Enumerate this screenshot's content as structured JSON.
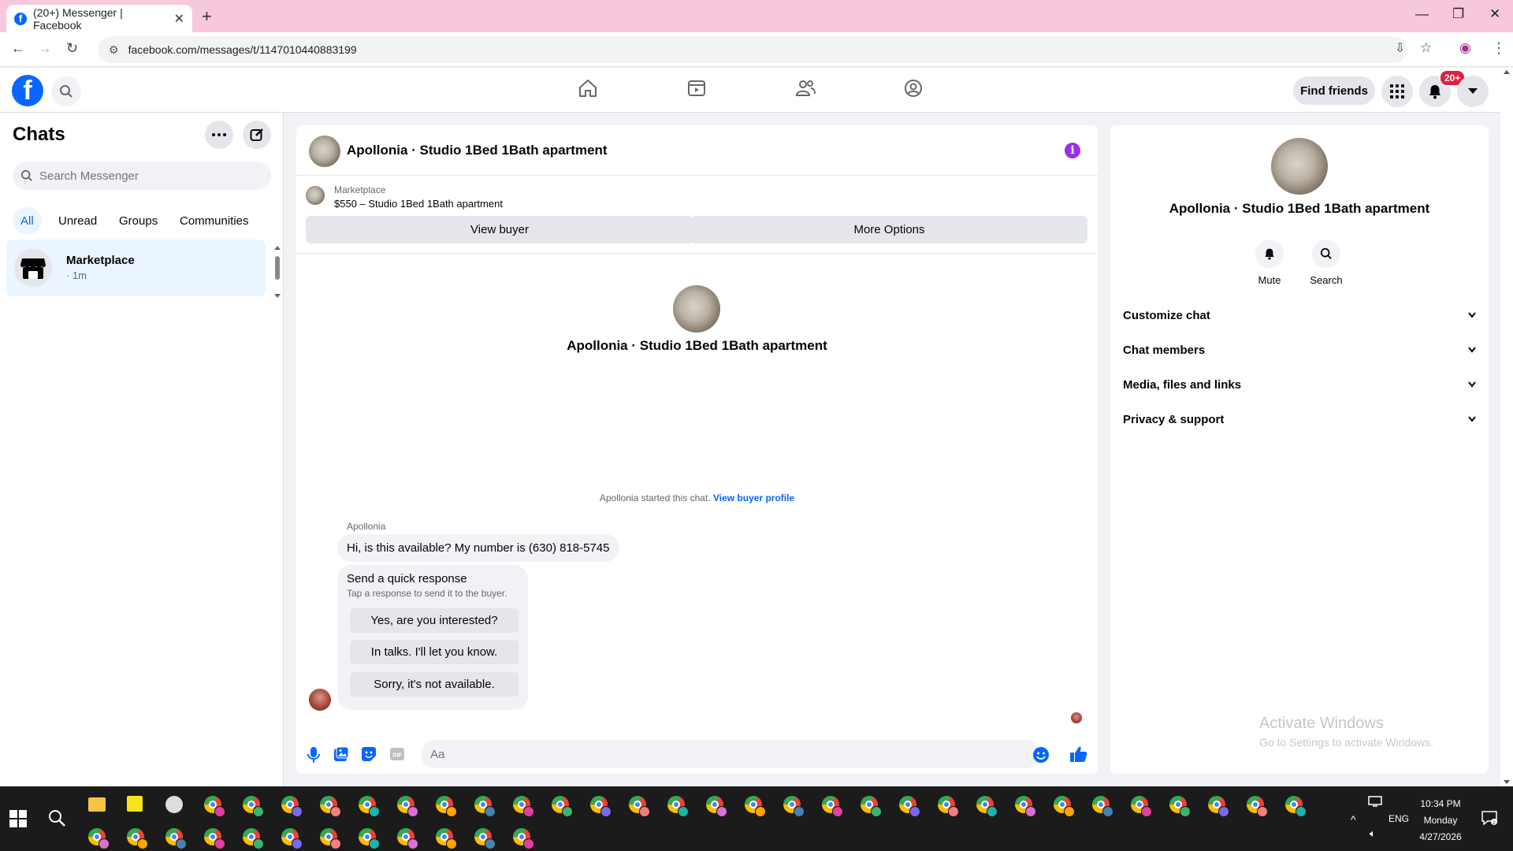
{
  "browser": {
    "tab_title": "(20+) Messenger | Facebook",
    "url": "facebook.com/messages/t/1147010440883199"
  },
  "header": {
    "find_friends": "Find friends",
    "notification_badge": "20+"
  },
  "sidebar": {
    "title": "Chats",
    "search_placeholder": "Search Messenger",
    "filters": [
      "All",
      "Unread",
      "Groups",
      "Communities"
    ],
    "active_filter": "All",
    "chats": [
      {
        "name": "Marketplace",
        "meta": "· 1m"
      }
    ]
  },
  "conversation": {
    "title": "Apollonia · Studio 1Bed 1Bath apartment",
    "marketplace_label": "Marketplace",
    "listing": "$550 – Studio 1Bed 1Bath apartment",
    "view_buyer": "View buyer",
    "more_options": "More Options",
    "profile_name": "Apollonia · Studio 1Bed 1Bath apartment",
    "started_text": "Apollonia started this chat.",
    "view_buyer_profile": "View buyer profile",
    "sender_name": "Apollonia",
    "message": "Hi, is this available? My number is (630) 818-5745",
    "quick_response_title": "Send a quick response",
    "quick_response_sub": "Tap a response to send it to the buyer.",
    "quick_responses": [
      "Yes, are you interested?",
      "In talks. I'll let you know.",
      "Sorry, it's not available."
    ],
    "input_placeholder": "Aa"
  },
  "details": {
    "name": "Apollonia · Studio 1Bed 1Bath apartment",
    "actions": [
      "Mute",
      "Search"
    ],
    "sections": [
      "Customize chat",
      "Chat members",
      "Media, files and links",
      "Privacy & support"
    ]
  },
  "watermark": {
    "line1": "Activate Windows",
    "line2": "Go to Settings to activate Windows."
  },
  "taskbar": {
    "time": "10:34 PM",
    "day": "Monday",
    "date": "4/27/2026",
    "lang": "ENG"
  },
  "colors": {
    "brand": "#0866ff",
    "tabbar": "#f7c8dc",
    "info": "#9b2cf5"
  }
}
